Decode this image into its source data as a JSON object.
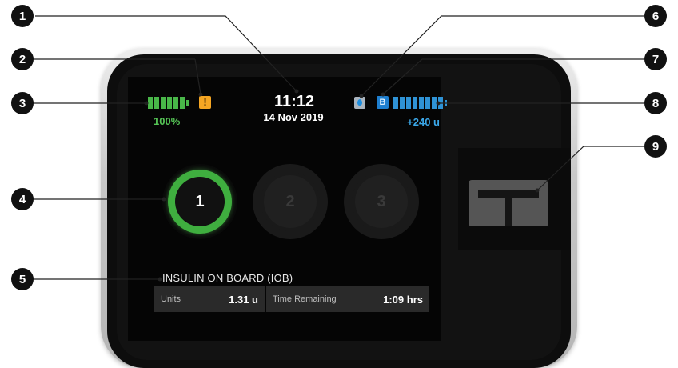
{
  "callouts": [
    "1",
    "2",
    "3",
    "4",
    "5",
    "6",
    "7",
    "8",
    "9"
  ],
  "status": {
    "battery_percent": "100%",
    "battery_level": 1.0,
    "alert_icon": "!",
    "time": "11:12",
    "date": "14 Nov 2019",
    "cgm_icon": "droplet-icon",
    "bolus_icon": "B",
    "insulin_remaining": "+240 u",
    "colors": {
      "battery": "#49b749",
      "alert": "#f5a623",
      "insulin": "#2f93d6"
    }
  },
  "profiles": [
    "1",
    "2",
    "3"
  ],
  "active_profile": "1",
  "iob": {
    "title": "INSULIN ON BOARD (IOB)",
    "units_label": "Units",
    "units_value": "1.31 u",
    "time_label": "Time Remaining",
    "time_value": "1:09 hrs"
  },
  "home_button_icon": "t-logo-icon"
}
